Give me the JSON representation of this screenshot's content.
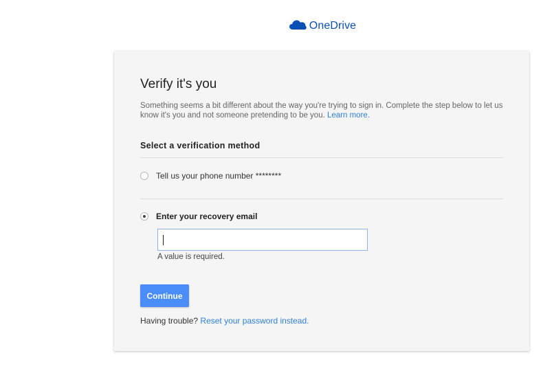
{
  "header": {
    "logo_text": "OneDrive",
    "brand_color": "#0a4fb3"
  },
  "card": {
    "title": "Verify it's you",
    "description": "Something seems a bit different about the way you're trying to sign in. Complete the step below to let us know it's you and not someone pretending to be you.",
    "learn_more": "Learn more.",
    "section_title": "Select a verification method",
    "options": [
      {
        "label": "Tell us your phone number ********",
        "selected": false
      },
      {
        "label": "Enter your recovery email",
        "selected": true
      }
    ],
    "email_input": {
      "value": "",
      "placeholder": ""
    },
    "error_message": "A value is required.",
    "continue_label": "Continue",
    "trouble_text": "Having trouble?",
    "reset_link": "Reset your password instead."
  },
  "colors": {
    "accent": "#4b8df8",
    "link": "#2d7fd8",
    "card_background": "#f5f5f5"
  }
}
